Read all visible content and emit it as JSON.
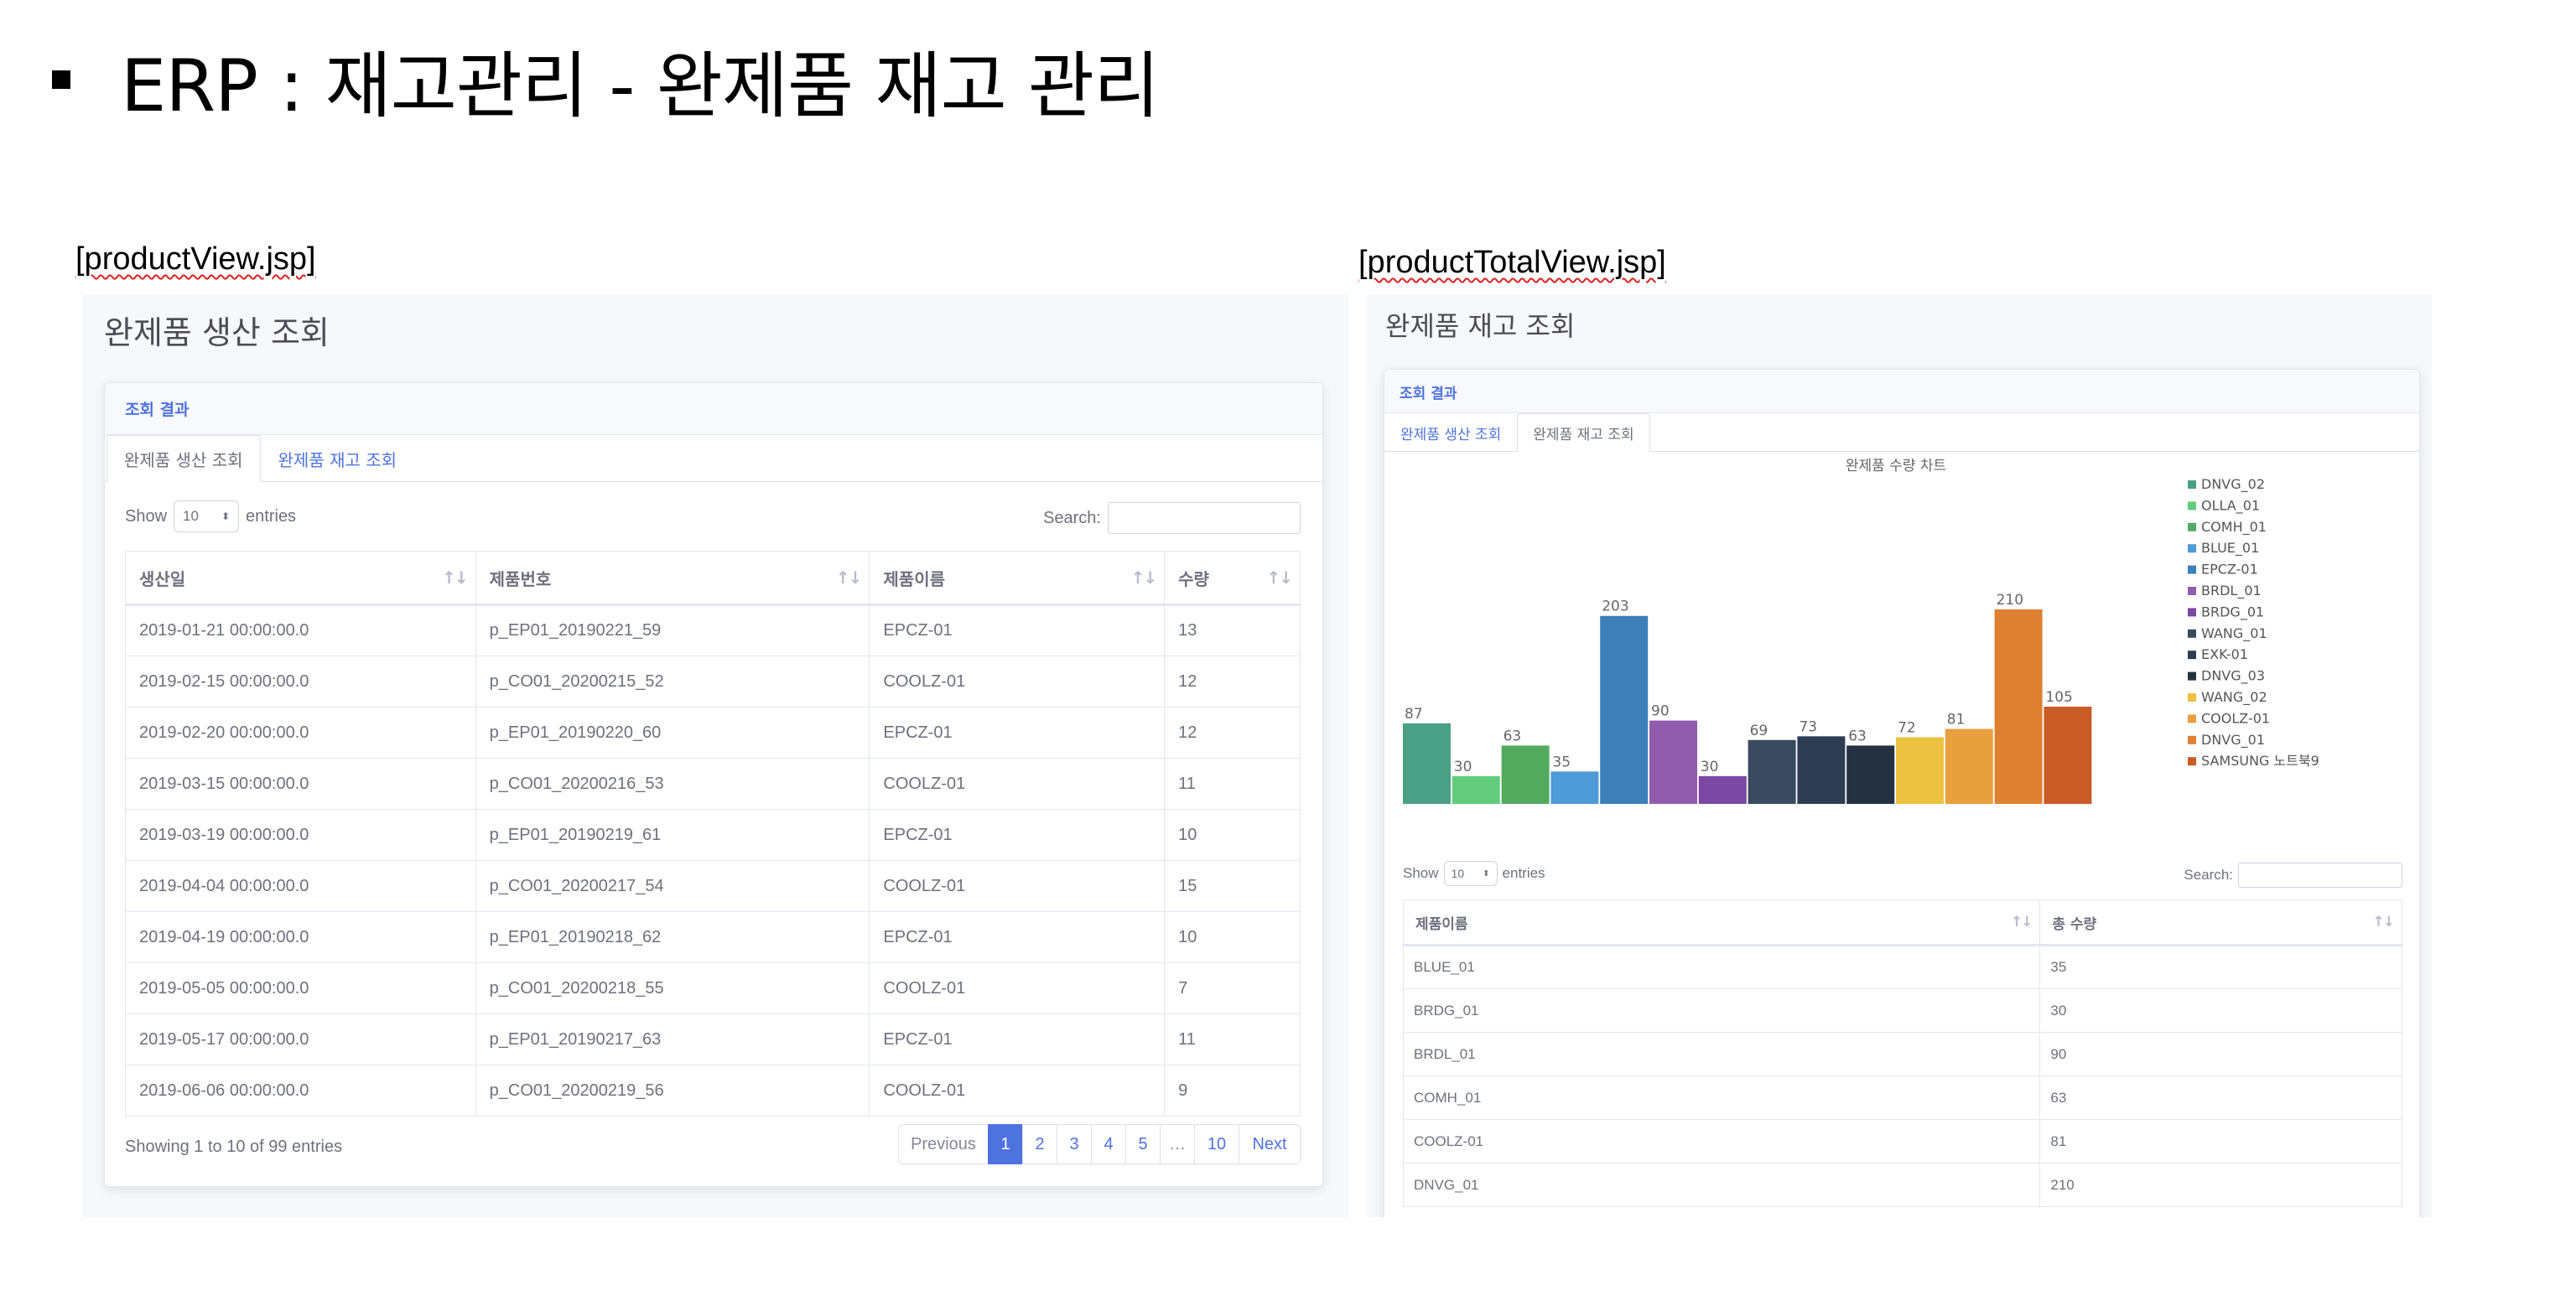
{
  "slide": {
    "title": "ERP : 재고관리 - 완제품 재고 관리"
  },
  "left": {
    "caption": "[productView.jsp]",
    "heading": "완제품 생산 조회",
    "card_header": "조회 결과",
    "tabs": [
      "완제품 생산 조회",
      "완제품 재고 조회"
    ],
    "show_label": "Show",
    "length_value": "10",
    "entries_label": "entries",
    "search_label": "Search:",
    "columns": [
      "생산일",
      "제품번호",
      "제품이름",
      "수량"
    ],
    "rows": [
      [
        "2019-01-21 00:00:00.0",
        "p_EP01_20190221_59",
        "EPCZ-01",
        "13"
      ],
      [
        "2019-02-15 00:00:00.0",
        "p_CO01_20200215_52",
        "COOLZ-01",
        "12"
      ],
      [
        "2019-02-20 00:00:00.0",
        "p_EP01_20190220_60",
        "EPCZ-01",
        "12"
      ],
      [
        "2019-03-15 00:00:00.0",
        "p_CO01_20200216_53",
        "COOLZ-01",
        "11"
      ],
      [
        "2019-03-19 00:00:00.0",
        "p_EP01_20190219_61",
        "EPCZ-01",
        "10"
      ],
      [
        "2019-04-04 00:00:00.0",
        "p_CO01_20200217_54",
        "COOLZ-01",
        "15"
      ],
      [
        "2019-04-19 00:00:00.0",
        "p_EP01_20190218_62",
        "EPCZ-01",
        "10"
      ],
      [
        "2019-05-05 00:00:00.0",
        "p_CO01_20200218_55",
        "COOLZ-01",
        "7"
      ],
      [
        "2019-05-17 00:00:00.0",
        "p_EP01_20190217_63",
        "EPCZ-01",
        "11"
      ],
      [
        "2019-06-06 00:00:00.0",
        "p_CO01_20200219_56",
        "COOLZ-01",
        "9"
      ]
    ],
    "info": "Showing 1 to 10 of 99 entries",
    "pagination": [
      "Previous",
      "1",
      "2",
      "3",
      "4",
      "5",
      "…",
      "10",
      "Next"
    ],
    "active_page": "1"
  },
  "right": {
    "caption": "[productTotalView.jsp]",
    "heading": "완제품 재고 조회",
    "card_header": "조회 결과",
    "tabs": [
      "완제품 생산 조회",
      "완제품 재고 조회"
    ],
    "show_label": "Show",
    "length_value": "10",
    "entries_label": "entries",
    "search_label": "Search:",
    "columns": [
      "제품이름",
      "총 수량"
    ],
    "rows": [
      [
        "BLUE_01",
        "35"
      ],
      [
        "BRDG_01",
        "30"
      ],
      [
        "BRDL_01",
        "90"
      ],
      [
        "COMH_01",
        "63"
      ],
      [
        "COOLZ-01",
        "81"
      ],
      [
        "DNVG_01",
        "210"
      ]
    ]
  },
  "chart_data": {
    "type": "bar",
    "title": "완제품 수량 차트",
    "categories": [
      "DNVG_02",
      "OLLA_01",
      "COMH_01",
      "BLUE_01",
      "EPCZ-01",
      "BRDL_01",
      "BRDG_01",
      "WANG_01",
      "EXK-01",
      "DNVG_03",
      "WANG_02",
      "COOLZ-01",
      "DNVG_01",
      "SAMSUNG 노트북9"
    ],
    "values": [
      87,
      30,
      63,
      35,
      203,
      90,
      30,
      69,
      73,
      63,
      72,
      81,
      210,
      105
    ],
    "colors": [
      "#4aa085",
      "#63cc7c",
      "#54ab60",
      "#4f9ad8",
      "#3d7fb8",
      "#905dae",
      "#7b48a3",
      "#3a4a60",
      "#2d3d52",
      "#243140",
      "#ecc240",
      "#e8a03e",
      "#de8031",
      "#c95c26"
    ],
    "legend_position": "right",
    "ylim": [
      0,
      240
    ],
    "data_labels": true
  }
}
